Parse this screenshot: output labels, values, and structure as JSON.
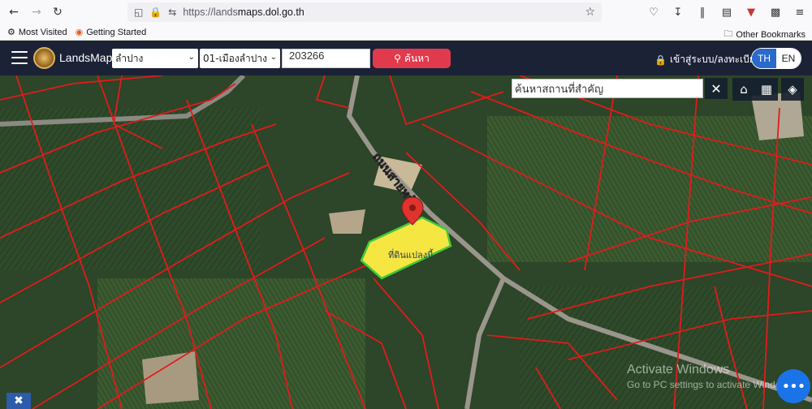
{
  "browser": {
    "url_prefix": "https://lands",
    "url_domain": "maps.dol.go.th",
    "bookmarks": [
      {
        "label": "Most Visited"
      },
      {
        "label": "Getting Started"
      }
    ],
    "other_bookmarks": "Other Bookmarks"
  },
  "app": {
    "title": "LandsMaps",
    "province_select": "ลำปาง",
    "district_select": "01-เมืองลำปาง",
    "parcel_number": "203266",
    "search_label": "ค้นหา",
    "login_label": "เข้าสู่ระบบ/ลงทะเบียน",
    "lang_th": "TH",
    "lang_en": "EN"
  },
  "map": {
    "place_search_value": "ค้นหาสถานที่สำคัญ",
    "road_label": "ถนนสายหลัก",
    "parcel_label": "ที่ดินแปลงนี้",
    "highlight_color": "#f5e642",
    "boundary_color": "#e21b1b"
  },
  "watermark": {
    "line1": "Activate Windows",
    "line2": "Go to PC settings to activate Windows."
  }
}
